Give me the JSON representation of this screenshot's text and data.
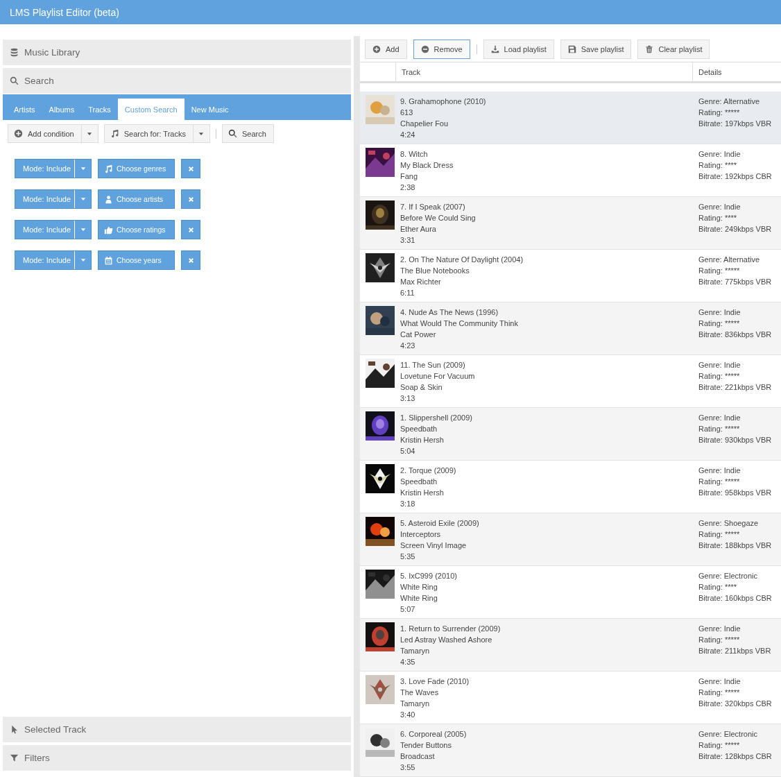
{
  "window": {
    "title": "LMS Playlist Editor (beta)"
  },
  "library": {
    "top_sections": [
      {
        "label": "Music Library",
        "kind": "database"
      },
      {
        "label": "Search",
        "kind": "search"
      }
    ],
    "tabs": [
      {
        "label": "Artists",
        "selected": false
      },
      {
        "label": "Albums",
        "selected": false
      },
      {
        "label": "Tracks",
        "selected": false
      },
      {
        "label": "Custom Search",
        "selected": true
      },
      {
        "label": "New Music",
        "selected": false
      }
    ],
    "toolbar": {
      "add_condition": "Add condition",
      "search_for": "Search for: Tracks",
      "search": "Search"
    },
    "conditions": [
      {
        "mode": "Mode: Include",
        "chooser": "Choose genres",
        "kind": "genres"
      },
      {
        "mode": "Mode: Include",
        "chooser": "Choose artists",
        "kind": "artists"
      },
      {
        "mode": "Mode: Include",
        "chooser": "Choose ratings",
        "kind": "ratings"
      },
      {
        "mode": "Mode: Include",
        "chooser": "Choose years",
        "kind": "years"
      }
    ],
    "bottom_sections": [
      {
        "label": "Selected Track",
        "kind": "pointer"
      },
      {
        "label": "Filters",
        "kind": "filter"
      }
    ]
  },
  "playlist": {
    "buttons": [
      {
        "label": "Add",
        "kind": "add",
        "selected": false
      },
      {
        "label": "Remove",
        "kind": "remove",
        "selected": true
      },
      {
        "label": "Load playlist",
        "kind": "load",
        "selected": false
      },
      {
        "label": "Save playlist",
        "kind": "save",
        "selected": false
      },
      {
        "label": "Clear playlist",
        "kind": "clear",
        "selected": false
      }
    ],
    "columns": [
      "Track",
      "Details"
    ],
    "rows": [
      {
        "selected": true,
        "track": [
          "9. Grahamophone (2010)",
          "613",
          "Chapelier Fou",
          "4:24"
        ],
        "details": [
          "Genre: Alternative",
          "Rating: *****",
          "Bitrate: 197kbps VBR"
        ]
      },
      {
        "selected": false,
        "track": [
          "8. Witch",
          "My Black Dress",
          "Fang",
          "2:38"
        ],
        "details": [
          "Genre: Indie",
          "Rating: ****",
          "Bitrate: 192kbps CBR"
        ]
      },
      {
        "selected": false,
        "track": [
          "7. If I Speak (2007)",
          "Before We Could Sing",
          "Ether Aura",
          "3:31"
        ],
        "details": [
          "Genre: Indie",
          "Rating: ****",
          "Bitrate: 249kbps VBR"
        ]
      },
      {
        "selected": false,
        "track": [
          "2. On The Nature Of Daylight (2004)",
          "The Blue Notebooks",
          "Max Richter",
          "6:11"
        ],
        "details": [
          "Genre: Alternative",
          "Rating: *****",
          "Bitrate: 775kbps VBR"
        ]
      },
      {
        "selected": false,
        "track": [
          "4. Nude As The News (1996)",
          "What Would The Community Think",
          "Cat Power",
          "4:23"
        ],
        "details": [
          "Genre: Indie",
          "Rating: *****",
          "Bitrate: 836kbps VBR"
        ]
      },
      {
        "selected": false,
        "track": [
          "11. The Sun (2009)",
          "Lovetune For Vacuum",
          "Soap & Skin",
          "3:13"
        ],
        "details": [
          "Genre: Indie",
          "Rating: *****",
          "Bitrate: 221kbps VBR"
        ]
      },
      {
        "selected": false,
        "track": [
          "1. Slippershell (2009)",
          "Speedbath",
          "Kristin Hersh",
          "5:04"
        ],
        "details": [
          "Genre: Indie",
          "Rating: *****",
          "Bitrate: 930kbps VBR"
        ]
      },
      {
        "selected": false,
        "track": [
          "2. Torque (2009)",
          "Speedbath",
          "Kristin Hersh",
          "3:18"
        ],
        "details": [
          "Genre: Indie",
          "Rating: *****",
          "Bitrate: 958kbps VBR"
        ]
      },
      {
        "selected": false,
        "track": [
          "5. Asteroid Exile (2009)",
          "Interceptors",
          "Screen Vinyl Image",
          "5:35"
        ],
        "details": [
          "Genre: Shoegaze",
          "Rating: *****",
          "Bitrate: 188kbps VBR"
        ]
      },
      {
        "selected": false,
        "track": [
          "5. IxC999 (2010)",
          "White Ring",
          "White Ring",
          "5:07"
        ],
        "details": [
          "Genre: Electronic",
          "Rating: ****",
          "Bitrate: 160kbps CBR"
        ]
      },
      {
        "selected": false,
        "track": [
          "1. Return to Surrender (2009)",
          "Led Astray Washed Ashore",
          "Tamaryn",
          "4:35"
        ],
        "details": [
          "Genre: Indie",
          "Rating: *****",
          "Bitrate: 211kbps VBR"
        ]
      },
      {
        "selected": false,
        "track": [
          "3. Love Fade (2010)",
          "The Waves",
          "Tamaryn",
          "3:40"
        ],
        "details": [
          "Genre: Indie",
          "Rating: *****",
          "Bitrate: 320kbps CBR"
        ]
      },
      {
        "selected": false,
        "track": [
          "6. Corporeal (2005)",
          "Tender Buttons",
          "Broadcast",
          "3:55"
        ],
        "details": [
          "Genre: Electronic",
          "Rating: *****",
          "Bitrate: 128kbps CBR"
        ]
      }
    ]
  }
}
